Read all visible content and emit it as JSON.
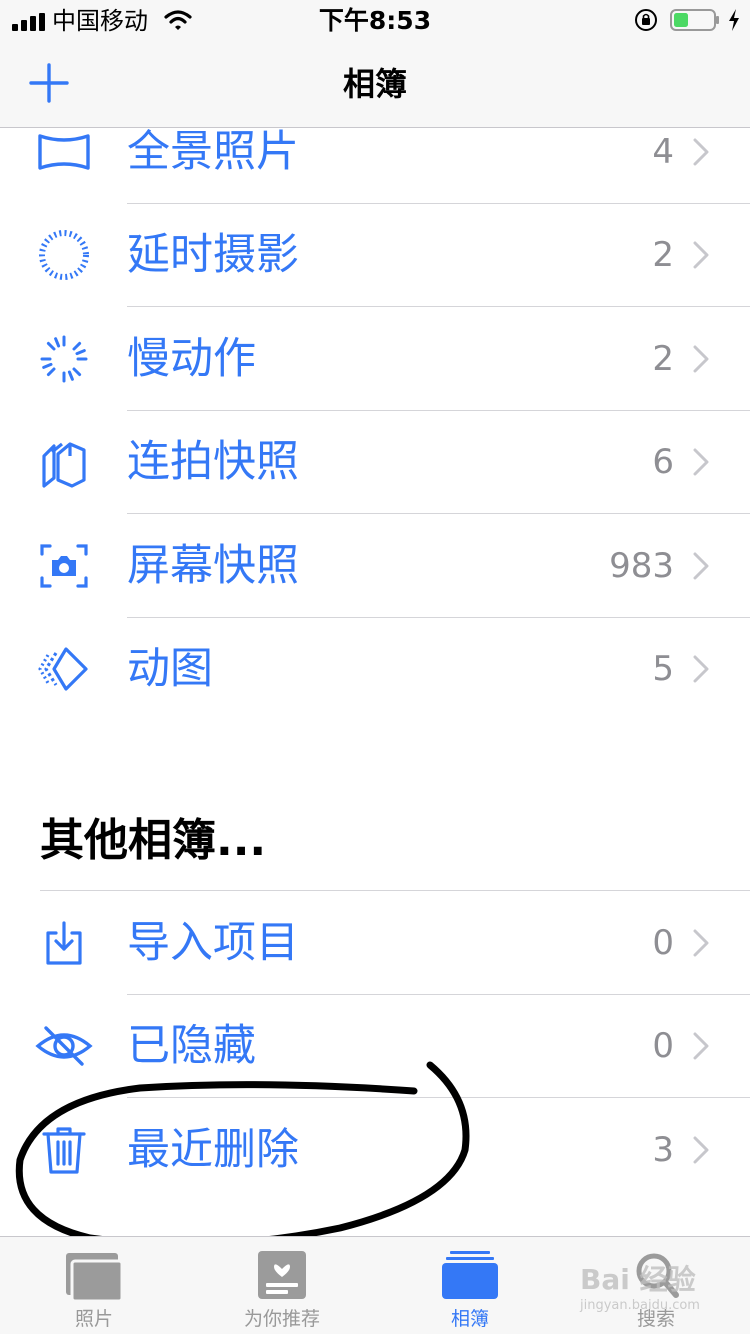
{
  "status_bar": {
    "carrier": "中国移动",
    "time": "下午8:53"
  },
  "nav": {
    "title": "相簿",
    "add_icon": "plus-icon"
  },
  "media_types": [
    {
      "label": "全景照片",
      "count": "4",
      "icon": "panorama-icon"
    },
    {
      "label": "延时摄影",
      "count": "2",
      "icon": "timelapse-icon"
    },
    {
      "label": "慢动作",
      "count": "2",
      "icon": "slomo-icon"
    },
    {
      "label": "连拍快照",
      "count": "6",
      "icon": "burst-icon"
    },
    {
      "label": "屏幕快照",
      "count": "983",
      "icon": "screenshot-icon"
    },
    {
      "label": "动图",
      "count": "5",
      "icon": "animated-icon"
    }
  ],
  "other_albums": {
    "title": "其他相簿...",
    "items": [
      {
        "label": "导入项目",
        "count": "0",
        "icon": "import-icon"
      },
      {
        "label": "已隐藏",
        "count": "0",
        "icon": "hidden-eye-icon"
      },
      {
        "label": "最近删除",
        "count": "3",
        "icon": "trash-icon"
      }
    ]
  },
  "tab_bar": {
    "tabs": [
      {
        "label": "照片",
        "icon": "photos-tab-icon",
        "active": false
      },
      {
        "label": "为你推荐",
        "icon": "for-you-tab-icon",
        "active": false
      },
      {
        "label": "相簿",
        "icon": "albums-tab-icon",
        "active": true
      },
      {
        "label": "搜索",
        "icon": "search-tab-icon",
        "active": false
      }
    ]
  },
  "watermark": {
    "text": "Bai 经验",
    "sub": "jingyan.baidu.com"
  },
  "colors": {
    "accent": "#3478f6",
    "secondary_text": "#8e8e93",
    "bar_background": "#f7f7f7",
    "annotation": "#000000"
  }
}
